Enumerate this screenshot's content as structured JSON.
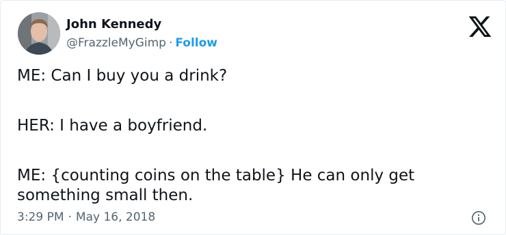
{
  "author": {
    "name": "John Kennedy",
    "handle": "@FrazzleMyGimp",
    "separator": "·",
    "follow_label": "Follow"
  },
  "tweet": {
    "lines": [
      "ME: Can I buy you a drink?",
      "HER: I have a boyfriend.",
      "ME: {counting coins on the table} He can only get something small then."
    ]
  },
  "meta": {
    "time": "3:29 PM",
    "separator": "·",
    "date": "May 16, 2018"
  },
  "icons": {
    "brand": "x-logo-icon",
    "info": "info-icon"
  },
  "colors": {
    "link": "#1d9bf0",
    "secondary_text": "#536471",
    "primary_text": "#0f1419"
  }
}
